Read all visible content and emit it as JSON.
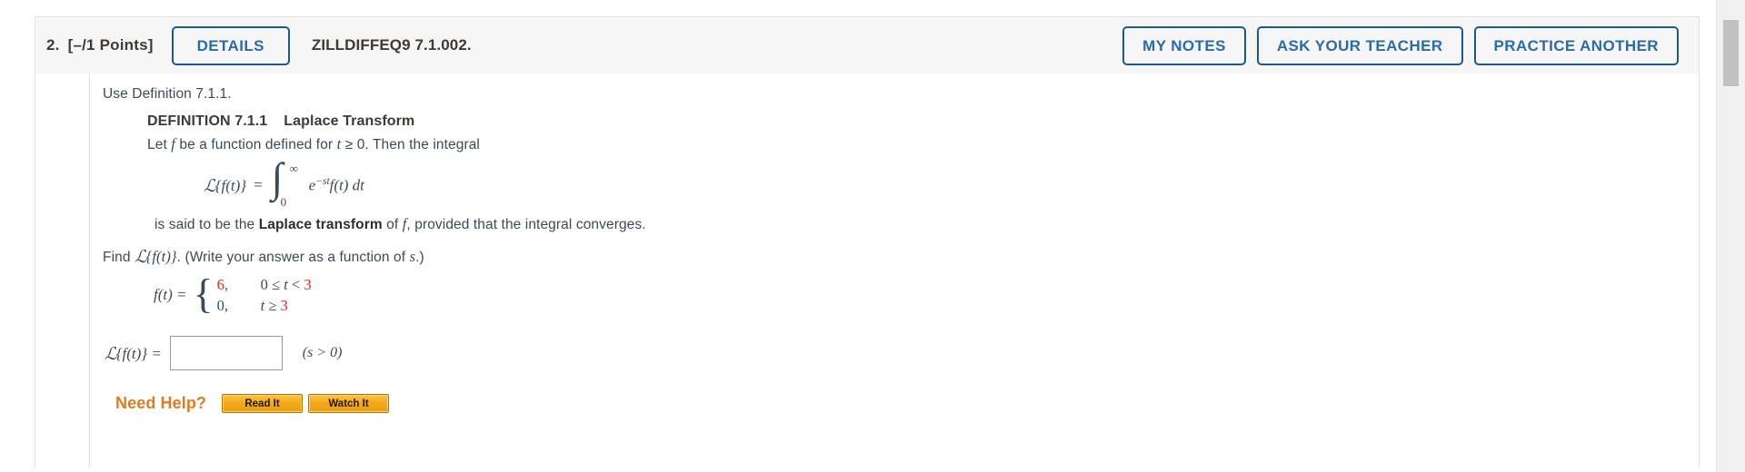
{
  "header": {
    "question_number": "2.",
    "points": "[–/1 Points]",
    "details_label": "DETAILS",
    "assignment_code": "ZILLDIFFEQ9 7.1.002.",
    "actions": [
      {
        "label": "MY NOTES",
        "name": "my-notes-button"
      },
      {
        "label": "ASK YOUR TEACHER",
        "name": "ask-your-teacher-button"
      },
      {
        "label": "PRACTICE ANOTHER",
        "name": "practice-another-button"
      }
    ]
  },
  "body": {
    "prompt": "Use Definition 7.1.1.",
    "definition": {
      "number": "DEFINITION 7.1.1",
      "name": "Laplace Transform",
      "intro_pre": "Let ",
      "intro_var": "f",
      "intro_mid": " be a function defined for ",
      "intro_var2": "t",
      "intro_post": " ≥ 0. Then the integral",
      "formula": {
        "lhs_script": "ℒ",
        "lhs_arg": "{f(t)}",
        "equals": "=",
        "integral_symbol": "∫",
        "upper_limit": "∞",
        "lower_limit": "0",
        "integrand_e": "e",
        "integrand_exp": "−st",
        "integrand_f": "f(t) dt"
      },
      "closing_pre": "is said to be the ",
      "closing_bold": "Laplace transform",
      "closing_mid": " of ",
      "closing_var": "f",
      "closing_post": ", provided that the integral converges."
    },
    "find_pre": "Find ",
    "find_script": "ℒ",
    "find_arg": "{f(t)}",
    "find_post": ". (Write your answer as a function of ",
    "find_var": "s",
    "find_end": ".)",
    "piecewise": {
      "lhs": "f(t)  =",
      "cases": [
        {
          "value": "6,",
          "value_red": true,
          "condition_pre": "0 ≤ ",
          "condition_var": "t",
          "condition_mid": " < ",
          "condition_num": "3",
          "condition_red": true
        },
        {
          "value": "0,",
          "value_red": false,
          "condition_pre": "",
          "condition_var": "t",
          "condition_mid": " ≥ ",
          "condition_num": "3",
          "condition_red": true
        }
      ]
    },
    "answer": {
      "label_script": "ℒ",
      "label_arg": "{f(t)}",
      "equals": "=",
      "input_value": "",
      "input_placeholder": "",
      "condition": "(s > 0)"
    },
    "need_help": {
      "label": "Need Help?",
      "buttons": [
        {
          "label": "Read It",
          "name": "read-it-button"
        },
        {
          "label": "Watch It",
          "name": "watch-it-button"
        }
      ]
    }
  },
  "colors": {
    "accent_blue": "#2a6ca8",
    "border_blue": "#1a5a8e",
    "red_value": "#e8261c",
    "orange": "#e07b20",
    "header_bg": "#f6f6f6",
    "text": "#3d4b57"
  }
}
